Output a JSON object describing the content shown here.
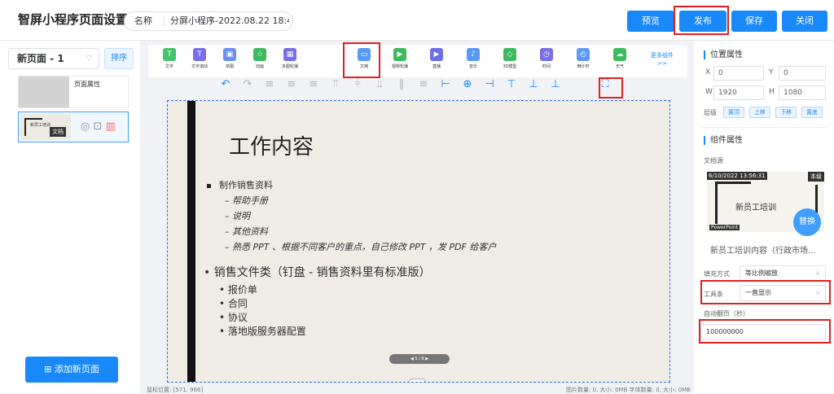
{
  "header": {
    "title": "智屏小程序页面设置",
    "name_label": "名称",
    "name_value": "分屏小程序-2022.08.22 18:4",
    "preview": "预览",
    "publish": "发布",
    "save": "保存",
    "close": "关闭"
  },
  "left": {
    "page_select": "新页面 - 1",
    "sort": "排序",
    "page_attr": "页面属性",
    "mini_title": "新员工培训",
    "mini_badge": "文档",
    "add_page": "添加新页面"
  },
  "toolbar": {
    "tools": [
      "文字",
      "文字滚动",
      "单图",
      "动画",
      "多图轮播",
      "文档",
      "视频轮播",
      "直播",
      "音乐",
      "3D模型",
      "时间",
      "倒计时",
      "天气"
    ],
    "more": "更多组件>>"
  },
  "slide": {
    "title": "工作内容",
    "bullet1": "制作销售资料",
    "subs": [
      "– 帮助手册",
      "– 说明",
      "– 其他资料",
      "– 熟悉 PPT 、根据不同客户的重点，自己修改 PPT ，发 PDF 给客户"
    ],
    "bullet2": "• 销售文件类（钉盘 - 销售资料里有标准版）",
    "items": [
      "• 报价单",
      "• 合同",
      "• 协议",
      "• 落地版服务器配置"
    ],
    "nav": "5 / 8"
  },
  "status": {
    "mouse": "鼠标位置: [571, 966]",
    "stats": "图片数量: 0, 大小: 0MB   字体数量: 0, 大小: 0MB"
  },
  "right": {
    "pos_title": "位置属性",
    "x_label": "X",
    "x_val": "0",
    "y_label": "Y",
    "y_val": "0",
    "w_label": "W",
    "w_val": "1920",
    "h_label": "H",
    "h_val": "1080",
    "level_label": "层级",
    "top": "置顶",
    "up": "上移",
    "down": "下移",
    "bottom": "置底",
    "comp_title": "组件属性",
    "doc_source": "文档源",
    "preview_date": "6/10/2022 13:56:31",
    "preview_badge": "本级",
    "preview_text": "新员工培训",
    "preview_pp": "PowerPoint",
    "replace": "替换",
    "filename": "新员工培训内容（行政市场...",
    "fill_label": "填充方式",
    "fill_val": "等比例缩放",
    "toolbar_label": "工具条",
    "toolbar_val": "一直显示",
    "autopage_label": "自动翻页（秒）",
    "autopage_val": "100000000"
  },
  "colors": {
    "primary": "#1989fa",
    "highlight": "#e02020"
  }
}
